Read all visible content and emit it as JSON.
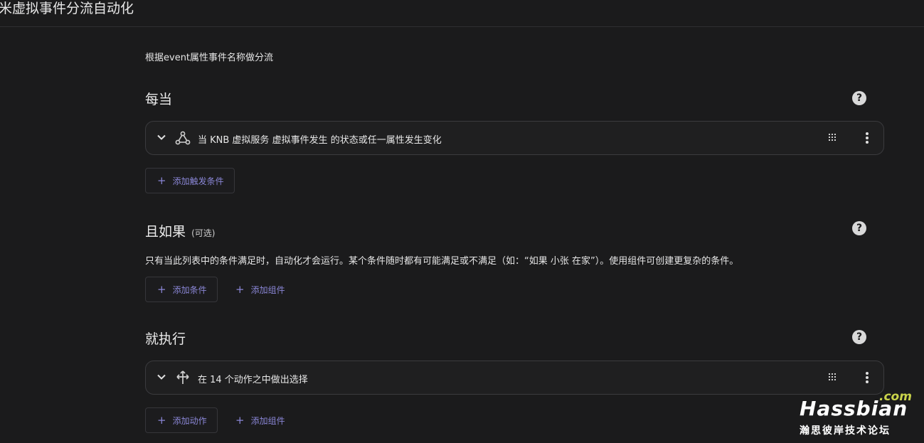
{
  "header": {
    "title": "米虚拟事件分流自动化"
  },
  "description": "根据event属性事件名称做分流",
  "triggers": {
    "title": "每当",
    "help_icon": "question-circle-icon",
    "items": [
      {
        "icon": "event-network-icon",
        "label": "当 KNB 虚拟服务 虚拟事件发生 的状态或任一属性发生变化"
      }
    ],
    "add_button": "添加触发条件"
  },
  "conditions": {
    "title": "且如果",
    "optional": "(可选)",
    "help_icon": "question-circle-icon",
    "description": "只有当此列表中的条件满足时，自动化才会运行。某个条件随时都有可能满足或不满足（如：“如果 小张 在家”）。使用组件可创建更复杂的条件。",
    "add_button": "添加条件",
    "add_block_button": "添加组件"
  },
  "actions": {
    "title": "就执行",
    "help_icon": "question-circle-icon",
    "items": [
      {
        "icon": "choose-arrows-icon",
        "label": "在 14 个动作之中做出选择"
      }
    ],
    "add_button": "添加动作",
    "add_block_button": "添加组件"
  },
  "watermark": {
    "com": ".com",
    "main": "Hassbian",
    "sub": "瀚思彼岸技术论坛"
  },
  "colors": {
    "background": "#1b1b1c",
    "accent": "#8a86d6"
  }
}
